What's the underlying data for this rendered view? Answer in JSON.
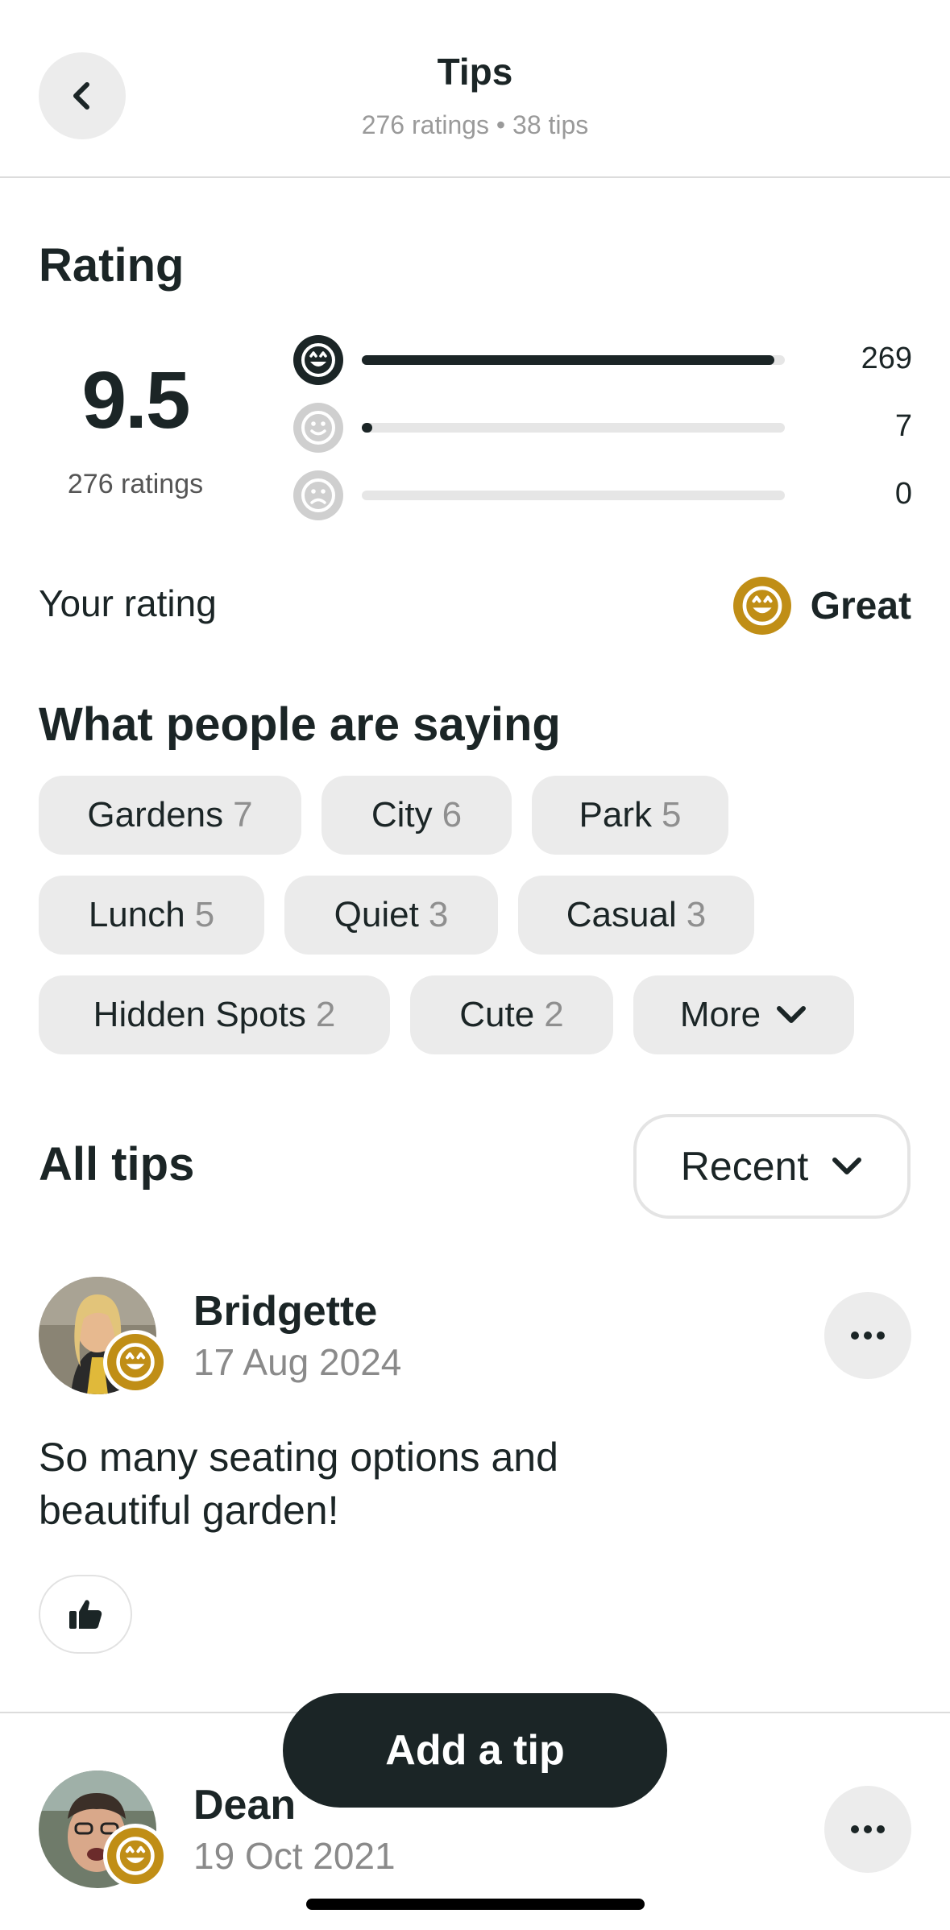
{
  "header": {
    "title": "Tips",
    "subtitle": "276 ratings • 38 tips",
    "back_icon": "chevron-left-icon"
  },
  "rating": {
    "section_title": "Rating",
    "score": "9.5",
    "score_caption": "276 ratings",
    "breakdown": [
      {
        "icon": "great-face-icon",
        "count": "269",
        "fraction": 0.975
      },
      {
        "icon": "okay-face-icon",
        "count": "7",
        "fraction": 0.025
      },
      {
        "icon": "bad-face-icon",
        "count": "0",
        "fraction": 0
      }
    ],
    "your_rating_label": "Your rating",
    "your_rating_value": "Great"
  },
  "saying": {
    "section_title": "What people are saying",
    "chips": [
      {
        "label": "Gardens",
        "count": "7"
      },
      {
        "label": "City",
        "count": "6"
      },
      {
        "label": "Park",
        "count": "5"
      },
      {
        "label": "Lunch",
        "count": "5"
      },
      {
        "label": "Quiet",
        "count": "3"
      },
      {
        "label": "Casual",
        "count": "3"
      },
      {
        "label": "Hidden Spots",
        "count": "2"
      },
      {
        "label": "Cute",
        "count": "2"
      }
    ],
    "more_label": "More"
  },
  "tips": {
    "section_title": "All tips",
    "sort_label": "Recent",
    "items": [
      {
        "name": "Bridgette",
        "date": "17 Aug 2024",
        "text": "So many seating options and beautiful garden!"
      },
      {
        "name": "Dean",
        "date": "19 Oct 2021"
      }
    ]
  },
  "actions": {
    "add_tip_label": "Add a tip"
  },
  "colors": {
    "dark": "#1b2526",
    "gold": "#c08e16",
    "chip_bg": "#ebebeb"
  }
}
